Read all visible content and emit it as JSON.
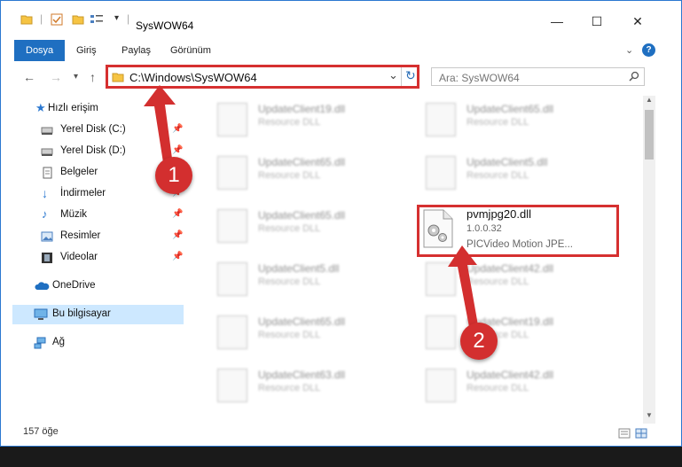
{
  "window": {
    "title": "SysWOW64",
    "minimize": "—",
    "maximize": "☐",
    "close": "✕"
  },
  "ribbon": {
    "tabs": [
      "Dosya",
      "Giriş",
      "Paylaş",
      "Görünüm"
    ],
    "expand": "⌄",
    "help": "?"
  },
  "address": {
    "path": "C:\\Windows\\SysWOW64",
    "dropdown": "⌄",
    "refresh": "↻"
  },
  "search": {
    "placeholder": "Ara: SysWOW64",
    "icon": "search-icon"
  },
  "nav": {
    "items": [
      {
        "label": "Hızlı erişim",
        "pinned": false
      },
      {
        "label": "Yerel Disk (C:)",
        "pinned": true
      },
      {
        "label": "Yerel Disk (D:)",
        "pinned": true
      },
      {
        "label": "Belgeler",
        "pinned": true
      },
      {
        "label": "İndirmeler",
        "pinned": true
      },
      {
        "label": "Müzik",
        "pinned": true
      },
      {
        "label": "Resimler",
        "pinned": true
      },
      {
        "label": "Videolar",
        "pinned": true
      },
      {
        "label": "OneDrive",
        "pinned": false
      },
      {
        "label": "Bu bilgisayar",
        "pinned": false
      },
      {
        "label": "Ağ",
        "pinned": false
      }
    ]
  },
  "files": {
    "left": [
      {
        "name": "UpdateClient19.dll",
        "type": "Resource DLL"
      },
      {
        "name": "UpdateClient65.dll",
        "type": "Resource DLL"
      },
      {
        "name": "UpdateClient65.dll",
        "type": "Resource DLL"
      },
      {
        "name": "UpdateClient5.dll",
        "type": "Resource DLL"
      },
      {
        "name": "UpdateClient65.dll",
        "type": "Resource DLL"
      },
      {
        "name": "UpdateClient63.dll",
        "type": "Resource DLL"
      }
    ],
    "right": [
      {
        "name": "UpdateClient65.dll",
        "type": "Resource DLL"
      },
      {
        "name": "UpdateClient5.dll",
        "type": "Resource DLL"
      },
      {
        "name": "pvmjpg20.dll",
        "version": "1.0.0.32",
        "type": "PICVideo Motion JPE..."
      },
      {
        "name": "UpdateClient42.dll",
        "type": "Resource DLL"
      },
      {
        "name": "UpdateClient19.dll",
        "type": "Resource DLL"
      },
      {
        "name": "UpdateClient42.dll",
        "type": "Resource DLL"
      }
    ]
  },
  "status": {
    "count": "157 öğe"
  },
  "callouts": {
    "one": "1",
    "two": "2"
  },
  "colors": {
    "accent": "#1f6fc1",
    "highlight": "#d63030",
    "badge": "#d32f2f"
  }
}
